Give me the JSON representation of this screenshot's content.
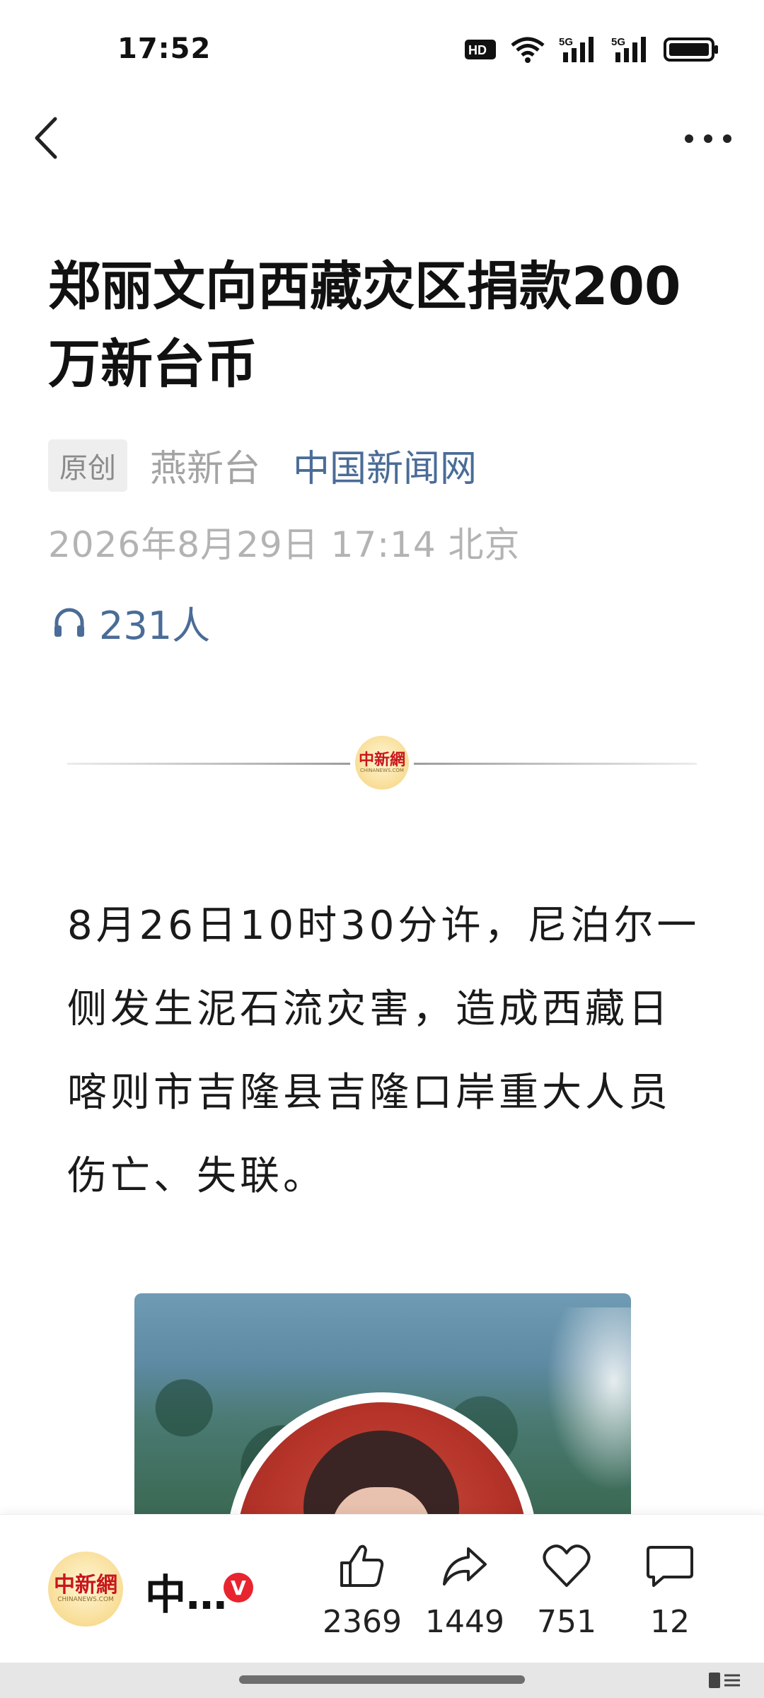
{
  "status_bar": {
    "time": "17:52",
    "icons": [
      "hd-icon",
      "wifi-icon",
      "signal-5g-icon",
      "signal-5g-icon",
      "battery-icon"
    ],
    "hd_label": "HD",
    "network_label": "5G"
  },
  "nav": {
    "back_icon": "chevron-left-icon",
    "more_icon": "more-dots-icon"
  },
  "article": {
    "title": "郑丽文向西藏灾区捐款200万新台币",
    "tag": "原创",
    "author": "燕新台",
    "source": "中国新闻网",
    "datetime": "2026年8月29日 17:14  北京",
    "listeners": "231人",
    "divider_logo_zh": "中新網",
    "divider_logo_en": "CHINANEWS.COM",
    "paragraph": "8月26日10时30分许，尼泊尔一侧发生泥石流灾害，造成西藏日喀则市吉隆县吉隆口岸重大人员伤亡、失联。"
  },
  "bottom_bar": {
    "account_logo_zh": "中新網",
    "account_logo_en": "CHINANEWS.COM",
    "account_name": "中…",
    "verified_badge": "V",
    "like_count": "2369",
    "share_count": "1449",
    "favorite_count": "751",
    "comment_count": "12"
  },
  "colors": {
    "link_blue": "#4a6c97",
    "verified_red": "#e8242e",
    "logo_red": "#c8161d"
  }
}
